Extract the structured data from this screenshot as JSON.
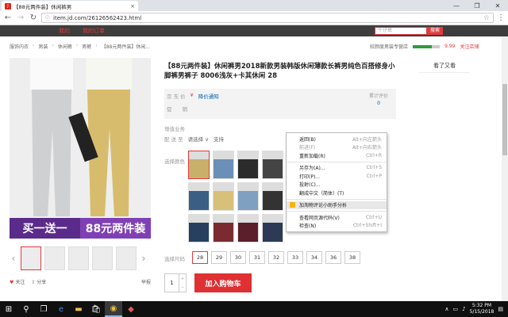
{
  "browser": {
    "tab_title": "【88元两件装】休闲裤男",
    "tab_close": "×",
    "url": "item.jd.com/26126562423.html",
    "window_controls": [
      "—",
      "❐",
      "✕"
    ]
  },
  "jd_nav": {
    "links": [
      "我的",
      "我的订单"
    ],
    "search_placeholder": "牛仔裤",
    "search_button": "搜索"
  },
  "breadcrumb": [
    "服饰内衣",
    "男装",
    "休闲裤",
    "男裤",
    "【88元两件装】休闲..."
  ],
  "shop": {
    "name": "姣颜度男装专营店",
    "score": "9.99",
    "follow": "关注店铺"
  },
  "product": {
    "title": "【88元两件装】休闲裤男2018新款男装韩版休闲薄款长裤男纯色百搭修身小脚裤男裤子 8006浅灰+卡其休闲 28",
    "price_label": "京 东 价",
    "price_symbol": "¥",
    "price_notify": "降价通知",
    "promo_label": "促　　销",
    "reviews_label": "累计评价",
    "reviews_count": "0",
    "service_label": "增值业务",
    "delivery_label": "配 送 至",
    "delivery_value": "请选择",
    "delivery_status": "支持",
    "color_label": "选择颜色",
    "size_label": "选择尺码",
    "sizes": [
      "28",
      "29",
      "30",
      "31",
      "32",
      "33",
      "34",
      "36",
      "38"
    ],
    "quantity": "1",
    "add_to_cart": "加入购物车",
    "promo_banner_a": "买一送一",
    "promo_banner_b": "88元两件装",
    "see_also": "看了又看"
  },
  "meta": {
    "follow": "关注",
    "share": "分享",
    "report": "举报"
  },
  "context_menu": {
    "items": [
      {
        "label": "返回(B)",
        "shortcut": "Alt+向左箭头",
        "disabled": false
      },
      {
        "label": "前进(F)",
        "shortcut": "Alt+向右箭头",
        "disabled": true
      },
      {
        "label": "重新加载(R)",
        "shortcut": "Ctrl+R",
        "disabled": false
      },
      {
        "label": "另存为(A)...",
        "shortcut": "Ctrl+S",
        "disabled": false
      },
      {
        "label": "打印(P)...",
        "shortcut": "Ctrl+P",
        "disabled": false
      },
      {
        "label": "投射(C)...",
        "shortcut": "",
        "disabled": false
      },
      {
        "label": "翻成中文（简体）(T)",
        "shortcut": "",
        "disabled": false
      },
      {
        "label": "加淘物评论小助手分析",
        "shortcut": "",
        "disabled": false
      },
      {
        "label": "查看网页源代码(V)",
        "shortcut": "Ctrl+U",
        "disabled": false
      },
      {
        "label": "检查(N)",
        "shortcut": "Ctrl+Shift+I",
        "disabled": false
      }
    ]
  },
  "taskbar": {
    "time": "5:32 PM",
    "date": "5/15/2018"
  }
}
